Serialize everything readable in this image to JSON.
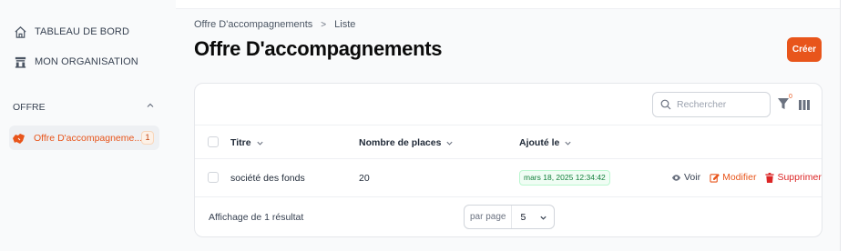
{
  "sidebar": {
    "items": [
      {
        "label": "TABLEAU DE BORD",
        "icon": "home-icon"
      },
      {
        "label": "MON ORGANISATION",
        "icon": "building-icon"
      }
    ],
    "section": {
      "label": "OFFRE",
      "icon": "chevron-up-icon"
    },
    "active_item": {
      "label": "Offre D'accompagneme...",
      "badge": "1",
      "icon": "handshake-icon"
    }
  },
  "breadcrumb": {
    "parent": "Offre D'accompagnements",
    "separator": ">",
    "current": "Liste"
  },
  "page": {
    "title": "Offre D'accompagnements"
  },
  "actions": {
    "create_label": "Créer"
  },
  "toolbar": {
    "search_placeholder": "Rechercher",
    "filter_count": "0"
  },
  "table": {
    "columns": [
      "Titre",
      "Nombre de places",
      "Ajouté le"
    ],
    "rows": [
      {
        "titre": "société des fonds",
        "places": "20",
        "ajoute_le": "mars 18, 2025 12:34:42"
      }
    ],
    "row_actions": {
      "view": "Voir",
      "edit": "Modifier",
      "delete": "Supprimer"
    }
  },
  "footer": {
    "summary": "Affichage de 1 résultat",
    "per_page_label": "par page",
    "per_page_value": "5"
  },
  "colors": {
    "accent": "#e8551b",
    "success_bg": "#f0fdf4",
    "success_text": "#15803d",
    "danger": "#dc2626"
  }
}
